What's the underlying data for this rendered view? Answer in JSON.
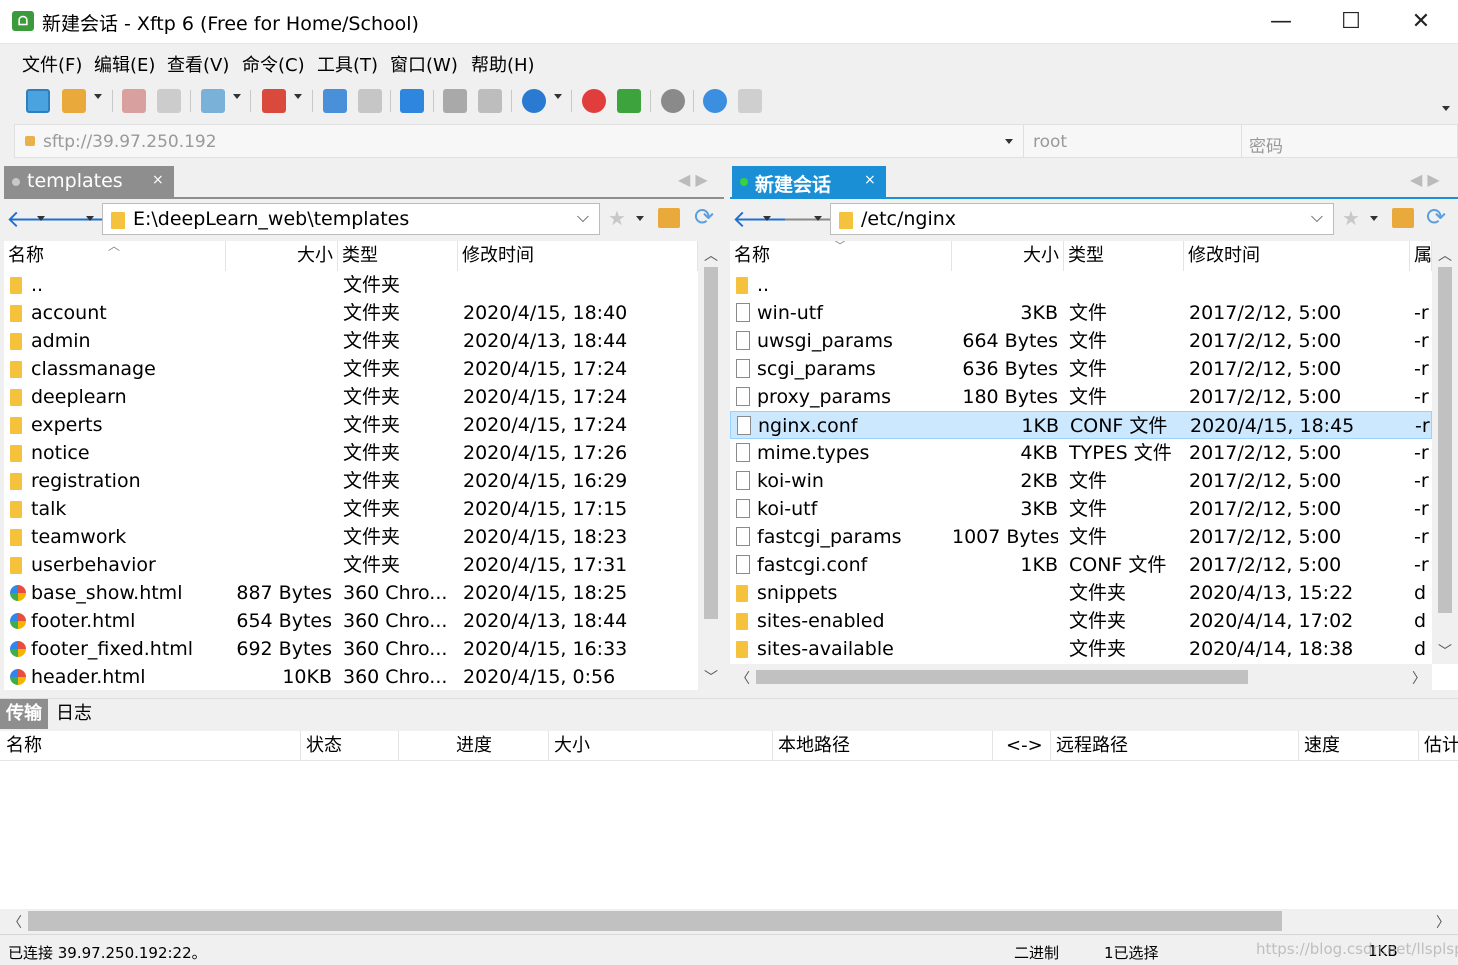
{
  "window": {
    "title": "新建会话 - Xftp 6 (Free for Home/School)",
    "app_icon_text": "ᗝ",
    "minimize": "—",
    "maximize": "☐",
    "close": "✕"
  },
  "menu": [
    "文件(F)",
    "编辑(E)",
    "查看(V)",
    "命令(C)",
    "工具(T)",
    "窗口(W)",
    "帮助(H)"
  ],
  "toolbar": {
    "icons": [
      "new-session-icon",
      "open-folder-icon",
      "connect-icon",
      "disconnect-icon",
      "session-manager-icon",
      "terminal-icon",
      "upload-icon",
      "download-icon",
      "sync-icon",
      "copy-icon",
      "paste-icon",
      "globe-icon",
      "xshell-icon",
      "xftp-icon",
      "settings-icon",
      "help-icon",
      "chat-icon"
    ]
  },
  "address": {
    "host_placeholder": "sftp://39.97.250.192",
    "user_placeholder": "root",
    "password_placeholder": "密码"
  },
  "left_pane": {
    "tab_label": "templates",
    "tab_close": "×",
    "path": "E:\\deepLearn_web\\templates",
    "columns": [
      "名称",
      "大小",
      "类型",
      "修改时间"
    ],
    "rows": [
      {
        "name": "..",
        "size": "",
        "type": "文件夹",
        "mtime": "",
        "icon": "folder"
      },
      {
        "name": "account",
        "size": "",
        "type": "文件夹",
        "mtime": "2020/4/15, 18:40",
        "icon": "folder"
      },
      {
        "name": "admin",
        "size": "",
        "type": "文件夹",
        "mtime": "2020/4/13, 18:44",
        "icon": "folder"
      },
      {
        "name": "classmanage",
        "size": "",
        "type": "文件夹",
        "mtime": "2020/4/15, 17:24",
        "icon": "folder"
      },
      {
        "name": "deeplearn",
        "size": "",
        "type": "文件夹",
        "mtime": "2020/4/15, 17:24",
        "icon": "folder"
      },
      {
        "name": "experts",
        "size": "",
        "type": "文件夹",
        "mtime": "2020/4/15, 17:24",
        "icon": "folder"
      },
      {
        "name": "notice",
        "size": "",
        "type": "文件夹",
        "mtime": "2020/4/15, 17:26",
        "icon": "folder"
      },
      {
        "name": "registration",
        "size": "",
        "type": "文件夹",
        "mtime": "2020/4/15, 16:29",
        "icon": "folder"
      },
      {
        "name": "talk",
        "size": "",
        "type": "文件夹",
        "mtime": "2020/4/15, 17:15",
        "icon": "folder"
      },
      {
        "name": "teamwork",
        "size": "",
        "type": "文件夹",
        "mtime": "2020/4/15, 18:23",
        "icon": "folder"
      },
      {
        "name": "userbehavior",
        "size": "",
        "type": "文件夹",
        "mtime": "2020/4/15, 17:31",
        "icon": "folder"
      },
      {
        "name": "base_show.html",
        "size": "887 Bytes",
        "type": "360 Chro...",
        "mtime": "2020/4/15, 18:25",
        "icon": "html"
      },
      {
        "name": "footer.html",
        "size": "654 Bytes",
        "type": "360 Chro...",
        "mtime": "2020/4/13, 18:44",
        "icon": "html"
      },
      {
        "name": "footer_fixed.html",
        "size": "692 Bytes",
        "type": "360 Chro...",
        "mtime": "2020/4/15, 16:33",
        "icon": "html"
      },
      {
        "name": "header.html",
        "size": "10KB",
        "type": "360 Chro...",
        "mtime": "2020/4/15, 0:56",
        "icon": "html"
      }
    ]
  },
  "right_pane": {
    "tab_label": "新建会话",
    "tab_close": "×",
    "path": "/etc/nginx",
    "columns": [
      "名称",
      "大小",
      "类型",
      "修改时间",
      "属"
    ],
    "rows": [
      {
        "name": "..",
        "size": "",
        "type": "",
        "mtime": "",
        "attr": "",
        "icon": "folder"
      },
      {
        "name": "win-utf",
        "size": "3KB",
        "type": "文件",
        "mtime": "2017/2/12, 5:00",
        "attr": "-r",
        "icon": "file"
      },
      {
        "name": "uwsgi_params",
        "size": "664 Bytes",
        "type": "文件",
        "mtime": "2017/2/12, 5:00",
        "attr": "-r",
        "icon": "file"
      },
      {
        "name": "scgi_params",
        "size": "636 Bytes",
        "type": "文件",
        "mtime": "2017/2/12, 5:00",
        "attr": "-r",
        "icon": "file"
      },
      {
        "name": "proxy_params",
        "size": "180 Bytes",
        "type": "文件",
        "mtime": "2017/2/12, 5:00",
        "attr": "-r",
        "icon": "file"
      },
      {
        "name": "nginx.conf",
        "size": "1KB",
        "type": "CONF 文件",
        "mtime": "2020/4/15, 18:45",
        "attr": "-r",
        "icon": "file",
        "selected": true
      },
      {
        "name": "mime.types",
        "size": "4KB",
        "type": "TYPES 文件",
        "mtime": "2017/2/12, 5:00",
        "attr": "-r",
        "icon": "file"
      },
      {
        "name": "koi-win",
        "size": "2KB",
        "type": "文件",
        "mtime": "2017/2/12, 5:00",
        "attr": "-r",
        "icon": "file"
      },
      {
        "name": "koi-utf",
        "size": "3KB",
        "type": "文件",
        "mtime": "2017/2/12, 5:00",
        "attr": "-r",
        "icon": "file"
      },
      {
        "name": "fastcgi_params",
        "size": "1007 Bytes",
        "type": "文件",
        "mtime": "2017/2/12, 5:00",
        "attr": "-r",
        "icon": "file"
      },
      {
        "name": "fastcgi.conf",
        "size": "1KB",
        "type": "CONF 文件",
        "mtime": "2017/2/12, 5:00",
        "attr": "-r",
        "icon": "file"
      },
      {
        "name": "snippets",
        "size": "",
        "type": "文件夹",
        "mtime": "2020/4/13, 15:22",
        "attr": "d",
        "icon": "folder"
      },
      {
        "name": "sites-enabled",
        "size": "",
        "type": "文件夹",
        "mtime": "2020/4/14, 17:02",
        "attr": "d",
        "icon": "folder"
      },
      {
        "name": "sites-available",
        "size": "",
        "type": "文件夹",
        "mtime": "2020/4/14, 18:38",
        "attr": "d",
        "icon": "folder"
      }
    ]
  },
  "bottom": {
    "tabs": [
      "传输",
      "日志"
    ],
    "columns": [
      "名称",
      "状态",
      "进度",
      "大小",
      "本地路径",
      "<->",
      "远程路径",
      "速度",
      "估计"
    ]
  },
  "status": {
    "connection": "已连接 39.97.250.192:22。",
    "mode": "二进制",
    "selected": "1已选择",
    "size": "1KB",
    "watermark": "https://blog.csdn.net/llsplsp"
  }
}
